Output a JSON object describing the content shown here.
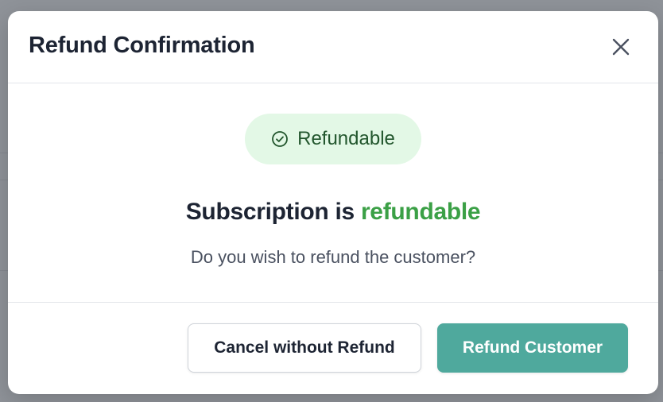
{
  "modal": {
    "title": "Refund Confirmation",
    "close_icon": "close-icon"
  },
  "status_badge": {
    "icon": "check-circle-icon",
    "label": "Refundable",
    "background": "#e3f8e6",
    "color": "#22562d"
  },
  "body": {
    "headline_prefix": "Subscription is ",
    "headline_accent": "refundable",
    "accent_color": "#3ba046",
    "question": "Do you wish to refund the customer?"
  },
  "footer": {
    "cancel_label": "Cancel without Refund",
    "refund_label": "Refund Customer",
    "refund_color": "#4fa99d"
  }
}
